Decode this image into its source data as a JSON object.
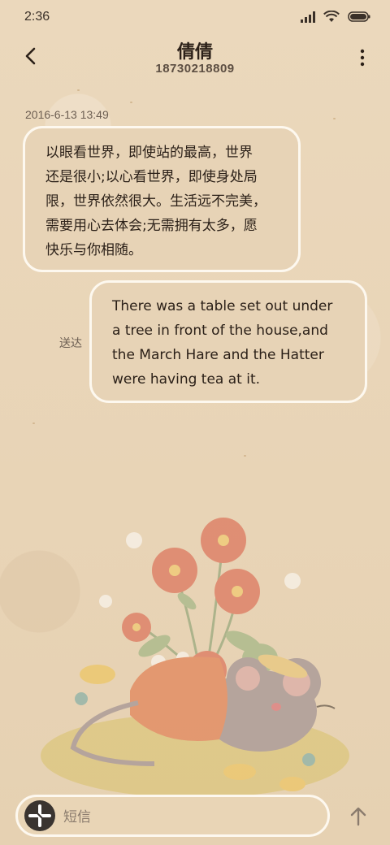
{
  "status": {
    "time": "2:36"
  },
  "header": {
    "contact_name": "倩倩",
    "phone": "18730218809"
  },
  "conversation": {
    "timestamp": "2016-6-13 13:49",
    "messages": [
      {
        "direction": "incoming",
        "lines": [
          "以眼看世界，即使站的最高，世界",
          "还是很小;以心看世界，即使身处局",
          "限，世界依然很大。生活远不完美，",
          "需要用心去体会;无需拥有太多，愿",
          "快乐与你相随。"
        ]
      },
      {
        "direction": "outgoing",
        "lines": [
          "There was a table set out under",
          "a tree in front of the house,and",
          "the March Hare and the Hatter",
          "were having tea at it."
        ],
        "status": "送达"
      }
    ]
  },
  "composer": {
    "placeholder": "短信"
  },
  "colors": {
    "background": "#e9d5b8",
    "bubble_fill": "#e7d3b6",
    "bubble_border": "#fdf8ef"
  }
}
